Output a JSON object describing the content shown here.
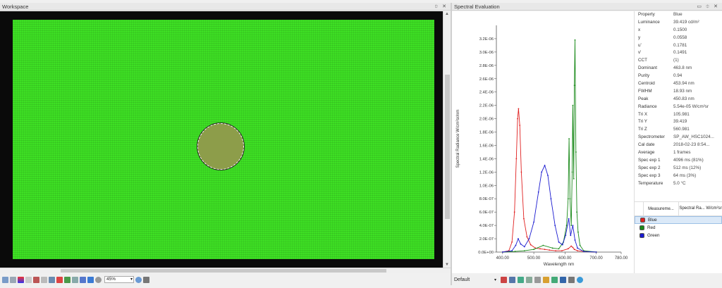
{
  "workspace": {
    "title": "Workspace",
    "controls": "⯐ ✕",
    "zoom": "45%"
  },
  "spectral": {
    "title": "Spectral Evaluation",
    "controls": "▭ ⯐ ✕",
    "bottom_label": "Default"
  },
  "properties": {
    "header": {
      "k": "Property",
      "v": "Blue"
    },
    "rows": [
      {
        "k": "Luminance",
        "v": "39.419 cd/m²"
      },
      {
        "k": "x",
        "v": "0.1500"
      },
      {
        "k": "y",
        "v": "0.0558"
      },
      {
        "k": "u'",
        "v": "0.1781"
      },
      {
        "k": "v'",
        "v": "0.1491"
      },
      {
        "k": "CCT",
        "v": "(1)"
      },
      {
        "k": "Dominant",
        "v": "463.8 nm"
      },
      {
        "k": "Purity",
        "v": "0.94"
      },
      {
        "k": "Centroid",
        "v": "453.94 nm"
      },
      {
        "k": "FWHM",
        "v": "18.93 nm"
      },
      {
        "k": "Peak",
        "v": "450.83 nm"
      },
      {
        "k": "Radiance",
        "v": "5.54e-05 W/cm²sr"
      },
      {
        "k": "Tri X",
        "v": "105.981"
      },
      {
        "k": "Tri Y",
        "v": "39.419"
      },
      {
        "k": "Tri Z",
        "v": "560.981"
      },
      {
        "k": "Spectrometer",
        "v": "SP_AW_HSC1024..."
      },
      {
        "k": "Cal date",
        "v": "2018-02-23 8:54..."
      },
      {
        "k": "Average",
        "v": "1 frames"
      },
      {
        "k": "Spec exp 1",
        "v": "4096 ms (81%)"
      },
      {
        "k": "Spec exp 2",
        "v": "512 ms (12%)"
      },
      {
        "k": "Spec exp 3",
        "v": "64 ms (3%)"
      },
      {
        "k": "Temperature",
        "v": "5.0 °C"
      }
    ]
  },
  "legend": {
    "col_measurement": "Measureme...",
    "col_radiance": "Spectral Ra... W/cm²sr",
    "items": [
      {
        "name": "Blue",
        "color": "#e02020",
        "selected": true
      },
      {
        "name": "Red",
        "color": "#1a8a1a",
        "selected": false
      },
      {
        "name": "Green",
        "color": "#1a1ad0",
        "selected": false
      }
    ]
  },
  "chart_data": {
    "type": "line",
    "xlabel": "Wavelength nm",
    "ylabel": "Spectral Radiance W/cm²sr/nm",
    "xlim": [
      380,
      780
    ],
    "ylim": [
      0,
      3.4e-06
    ],
    "xticks": [
      "400.00",
      "500.00",
      "600.00",
      "700.00",
      "780.00"
    ],
    "xtick_values": [
      400,
      500,
      600,
      700,
      780
    ],
    "yticks": [
      "0.0E+00",
      "2.0E-07",
      "4.0E-07",
      "6.0E-07",
      "8.0E-07",
      "1.0E-06",
      "1.2E-06",
      "1.4E-06",
      "1.6E-06",
      "1.8E-06",
      "2.0E-06",
      "2.2E-06",
      "2.4E-06",
      "2.6E-06",
      "2.8E-06",
      "3.0E-06",
      "3.2E-06"
    ],
    "ytick_values": [
      0,
      2e-07,
      4e-07,
      6e-07,
      8e-07,
      1e-06,
      1.2e-06,
      1.4e-06,
      1.6e-06,
      1.8e-06,
      2e-06,
      2.2e-06,
      2.4e-06,
      2.6e-06,
      2.8e-06,
      3e-06,
      3.2e-06
    ],
    "series": [
      {
        "name": "Blue",
        "color": "#e02020",
        "x": [
          400,
          420,
          430,
          438,
          444,
          448,
          451,
          455,
          460,
          468,
          478,
          490,
          505,
          520,
          535,
          550,
          570,
          590,
          610,
          620,
          625,
          630,
          640,
          660,
          700
        ],
        "y": [
          0,
          2e-08,
          1.5e-07,
          6e-07,
          1.4e-06,
          2e-06,
          2.15e-06,
          1.9e-06,
          1.2e-06,
          5e-07,
          2.3e-07,
          1.1e-07,
          6e-08,
          5e-08,
          4e-08,
          3e-08,
          2e-08,
          2e-08,
          5e-08,
          9e-08,
          7e-08,
          4e-08,
          2e-08,
          1e-08,
          0
        ]
      },
      {
        "name": "Red",
        "color": "#1a8a1a",
        "x": [
          400,
          440,
          470,
          500,
          530,
          560,
          580,
          595,
          605,
          610,
          613,
          616,
          620,
          623,
          625,
          628,
          630,
          632,
          635,
          638,
          642,
          648,
          660,
          700
        ],
        "y": [
          0,
          1e-08,
          2e-08,
          4e-08,
          1e-07,
          6e-08,
          5e-08,
          1.5e-07,
          4e-07,
          8e-07,
          1.7e-06,
          8e-07,
          4e-07,
          1.2e-06,
          2.2e-06,
          1.1e-06,
          2.5e-06,
          3.18e-06,
          1.5e-06,
          6e-07,
          3e-07,
          1e-07,
          2e-08,
          0
        ]
      },
      {
        "name": "Green",
        "color": "#1a1ad0",
        "x": [
          400,
          430,
          442,
          450,
          458,
          470,
          485,
          500,
          515,
          525,
          535,
          545,
          555,
          568,
          580,
          592,
          602,
          612,
          618,
          625,
          632,
          640,
          660,
          700
        ],
        "y": [
          0,
          2e-08,
          1e-07,
          2e-07,
          1.2e-07,
          8e-08,
          2e-07,
          4.5e-07,
          9e-07,
          1.2e-06,
          1.3e-06,
          1.15e-06,
          8e-07,
          4e-07,
          1.5e-07,
          1.1e-07,
          2.5e-07,
          5e-07,
          2.5e-07,
          4e-07,
          1.8e-07,
          6e-08,
          1e-08,
          0
        ]
      }
    ]
  }
}
